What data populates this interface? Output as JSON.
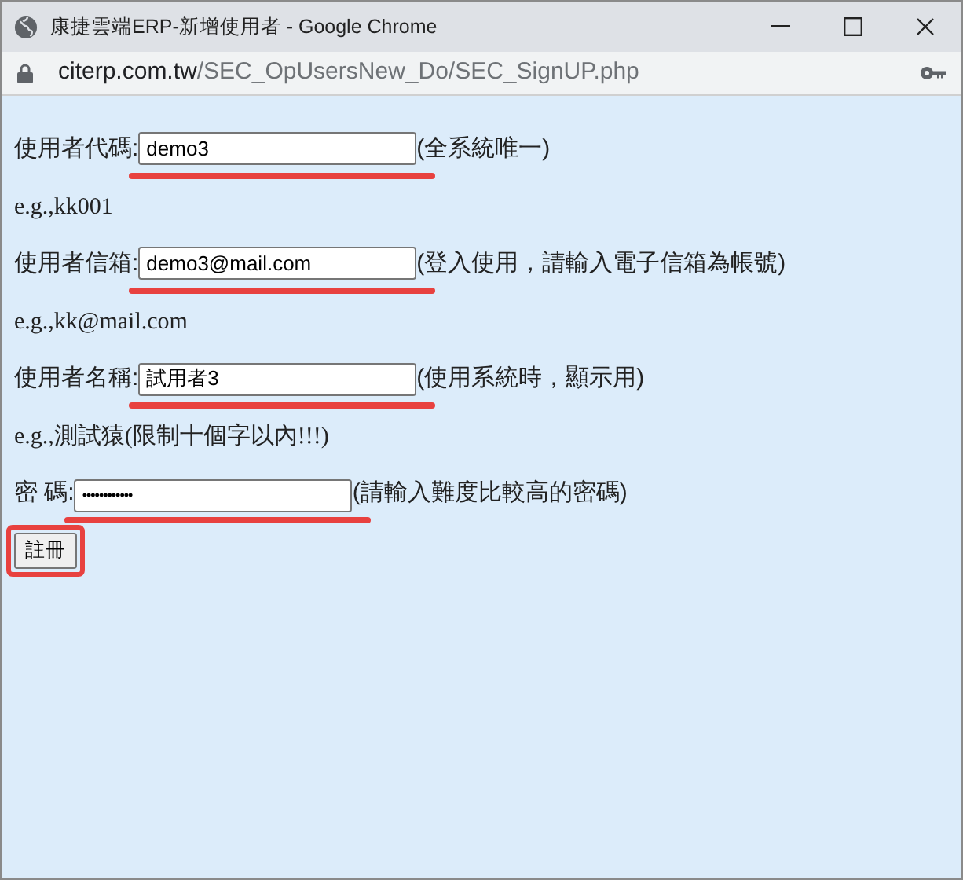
{
  "window": {
    "title": "康捷雲端ERP-新增使用者 - Google Chrome"
  },
  "address_bar": {
    "host": "citerp.com.tw",
    "path": "/SEC_OpUsersNew_Do/SEC_SignUP.php"
  },
  "form": [
    {
      "kind": "field",
      "label": "使用者代碼:",
      "value": "demo3",
      "note": "(全系統唯一)",
      "annotated": true
    },
    {
      "kind": "example",
      "text": "e.g.,kk001"
    },
    {
      "kind": "field",
      "label": "使用者信箱:",
      "value": "demo3@mail.com",
      "note": "(登入使用，請輸入電子信箱為帳號)",
      "annotated": true
    },
    {
      "kind": "example",
      "text": "e.g.,kk@mail.com"
    },
    {
      "kind": "field",
      "label": "使用者名稱:",
      "value": "試用者3",
      "note": "(使用系統時，顯示用)",
      "annotated": true
    },
    {
      "kind": "example",
      "text": "e.g.,測試猿(限制十個字以內!!!)"
    },
    {
      "kind": "password",
      "label": "密 碼:",
      "value": "••••••••••••",
      "note": "(請輸入難度比較高的密碼)",
      "annotated": true
    }
  ],
  "submit": {
    "label": "註冊",
    "annotated": true
  }
}
